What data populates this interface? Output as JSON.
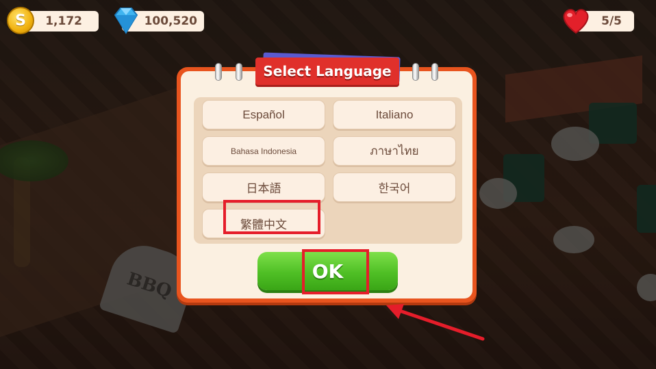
{
  "hud": {
    "coins": "1,172",
    "coin_symbol": "S",
    "gems": "100,520",
    "lives": "5/5"
  },
  "dialog": {
    "title": "Select Language",
    "languages": [
      "Español",
      "Italiano",
      "Bahasa Indonesia",
      "ภาษาไทย",
      "日本語",
      "한국어",
      "繁體中文"
    ],
    "ok_label": "OK"
  },
  "background": {
    "sign_text": "BBQ"
  },
  "colors": {
    "dialog_frame": "#e8541e",
    "title_ribbon": "#e0302b",
    "ok_button": "#4fbf25",
    "highlight": "#e51d2a"
  },
  "annotations": {
    "highlighted": [
      "繁體中文",
      "OK"
    ],
    "arrow_target": "OK"
  }
}
